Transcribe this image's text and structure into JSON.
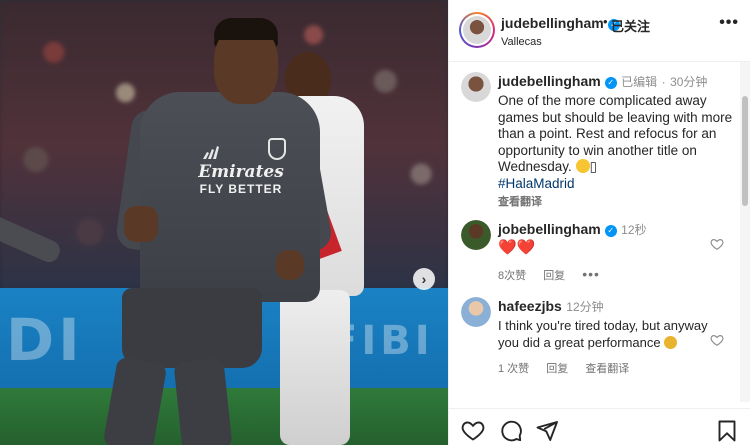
{
  "post": {
    "author": "judebellingham",
    "follow_status": "已关注",
    "location": "Vallecas",
    "more_label": "•••"
  },
  "caption": {
    "username": "judebellingham",
    "edited": "已编辑",
    "time": "30分钟",
    "text": "One of the more complicated away games but should be leaving with more than a point. Rest and refocus for an opportunity to win another title on Wednesday.",
    "trailing_glyph": "▯",
    "hashtag": "#HalaMadrid",
    "see_translation": "查看翻译"
  },
  "comments": [
    {
      "username": "jobebellingham",
      "time": "12秒",
      "text": "❤️❤️",
      "likes": "8次赞",
      "reply": "回复",
      "more": "•••"
    },
    {
      "username": "hafeezjbs",
      "time": "12分钟",
      "text": "I think you're tired today, but anyway you did a great performance",
      "likes": "1 次赞",
      "reply": "回复",
      "see_translation": "查看翻译"
    }
  ],
  "photo": {
    "sponsor_line1": "Emirates",
    "sponsor_line2": "FLY BETTER",
    "board_text_left": "DI",
    "board_text_right": "FIBI"
  },
  "icons": {
    "like": "heart-icon",
    "comment": "comment-icon",
    "share": "share-icon",
    "save": "bookmark-icon",
    "next": "chevron-right-icon"
  },
  "colors": {
    "verified": "#0095f6",
    "hashtag": "#00376b",
    "heart": "#ed4956"
  }
}
